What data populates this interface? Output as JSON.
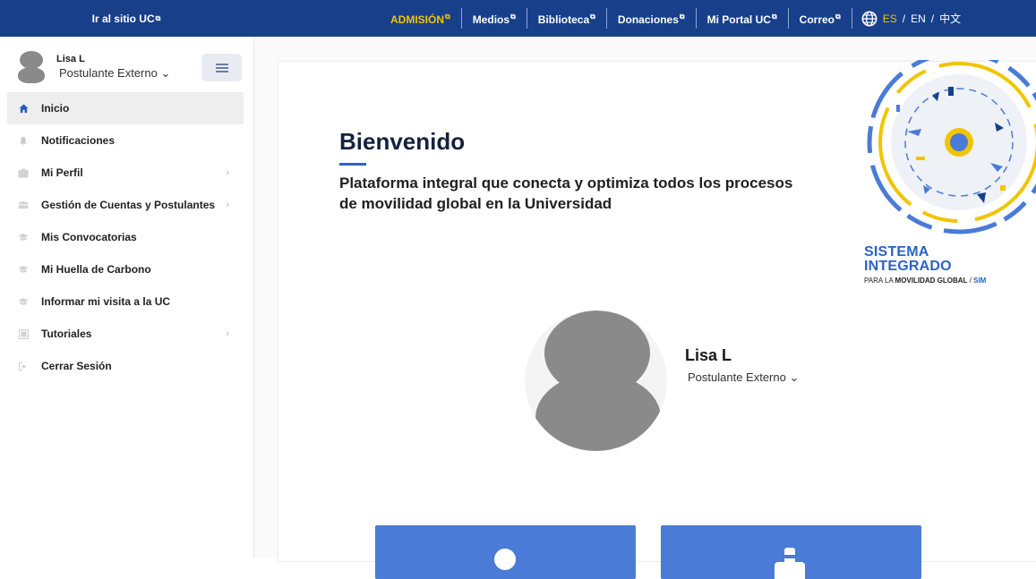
{
  "topbar": {
    "site_link": "Ir al sitio UC",
    "nav": [
      "ADMISIÓN",
      "Medios",
      "Biblioteca",
      "Donaciones",
      "Mi Portal UC",
      "Correo"
    ],
    "lang_es": "ES",
    "lang_en": "EN",
    "lang_zh": "中文",
    "sep": "/"
  },
  "sidebar": {
    "user_name": "Lisa L",
    "user_role": "Postulante Externo ⌄",
    "items": [
      {
        "label": "Inicio",
        "icon": "home-icon",
        "active": true
      },
      {
        "label": "Notificaciones",
        "icon": "bell-icon"
      },
      {
        "label": "Mi Perfil",
        "icon": "profile-icon",
        "chevron": true
      },
      {
        "label": "Gestión de Cuentas y Postulantes",
        "icon": "users-icon",
        "chevron": true
      },
      {
        "label": "Mis Convocatorias",
        "icon": "graduation-cap-icon"
      },
      {
        "label": "Mi Huella de Carbono",
        "icon": "graduation-cap-icon"
      },
      {
        "label": "Informar mi visita a la UC",
        "icon": "graduation-cap-icon"
      },
      {
        "label": "Tutoriales",
        "icon": "video-icon",
        "chevron": true
      },
      {
        "label": "Cerrar Sesión",
        "icon": "logout-icon"
      }
    ]
  },
  "main": {
    "title": "Bienvenido",
    "tagline": "Plataforma integral que conecta y optimiza todos los procesos de movilidad global en la Universidad",
    "logo_line1": "SISTEMA",
    "logo_line2": "INTEGRADO",
    "logo_sub_pre": "PARA LA ",
    "logo_sub_bold": "MOVILIDAD GLOBAL",
    "logo_sub_sep": " / ",
    "logo_sub_sim": "SIM",
    "profile_name": "Lisa L",
    "profile_role": "Postulante Externo ⌄"
  },
  "colors": {
    "topbar": "#173f8a",
    "accent": "#2a63c9",
    "highlight": "#f1c400",
    "tile": "#4a7bd6"
  }
}
